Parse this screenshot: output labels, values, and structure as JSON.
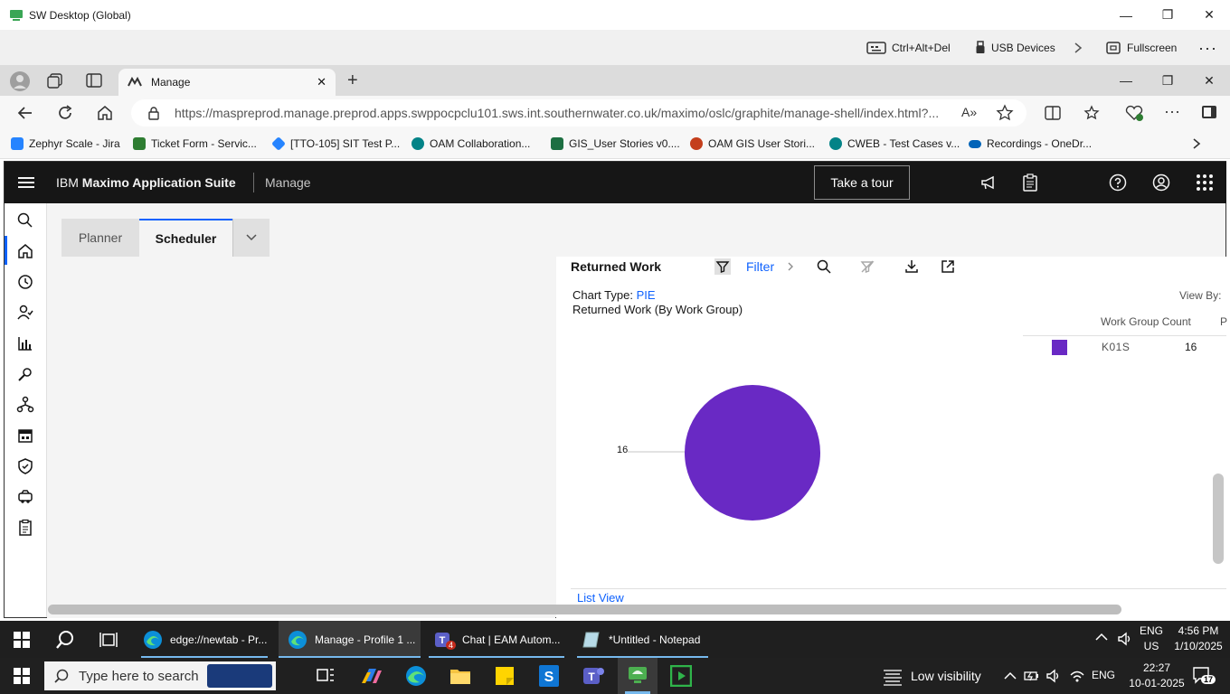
{
  "sw_window": {
    "title": "SW Desktop (Global)"
  },
  "sw_toolbar": {
    "ctrl_alt_del": "Ctrl+Alt+Del",
    "usb_devices": "USB Devices",
    "fullscreen": "Fullscreen"
  },
  "browser": {
    "tab_title": "Manage",
    "url": "https://maspreprod.manage.preprod.apps.swppocpclu101.sws.int.southernwater.co.uk/maximo/oslc/graphite/manage-shell/index.html?...",
    "bookmarks": [
      {
        "label": "Zephyr Scale - Jira",
        "color": "#2684ff"
      },
      {
        "label": "Ticket Form - Servic...",
        "color": "#2e7d32"
      },
      {
        "label": "[TTO-105] SIT Test P...",
        "color": "#2684ff"
      },
      {
        "label": "OAM Collaboration...",
        "color": "#038387"
      },
      {
        "label": "GIS_User Stories v0....",
        "color": "#1d6f42"
      },
      {
        "label": "OAM GIS User Stori...",
        "color": "#c43e1c"
      },
      {
        "label": "CWEB - Test Cases v...",
        "color": "#038387"
      },
      {
        "label": "Recordings - OneDr...",
        "color": "#0364b8"
      }
    ]
  },
  "maximo": {
    "brand_prefix": "IBM",
    "brand_name": "Maximo Application Suite",
    "product": "Manage",
    "tour_button": "Take a tour",
    "tabs": [
      "Planner",
      "Scheduler"
    ],
    "card": {
      "title": "Returned Work",
      "filter_label": "Filter",
      "chart_type_label": "Chart Type:",
      "chart_type_value": "PIE",
      "subtitle": "Returned Work (By Work Group)",
      "view_by": "View By:",
      "legend_header": "Work Group Count",
      "legend_header_trunc": "P",
      "list_view": "List View"
    }
  },
  "chart_data": {
    "type": "pie",
    "subtitle": "Returned Work (By Work Group)",
    "categories": [
      "K01S"
    ],
    "values": [
      16
    ],
    "colors": [
      "#6929c4"
    ],
    "data_labels": [
      "16"
    ]
  },
  "taskbar": {
    "items": [
      {
        "label": "edge://newtab - Pr..."
      },
      {
        "label": "Manage - Profile 1 ..."
      },
      {
        "label": "Chat | EAM Autom...",
        "badge": "4"
      },
      {
        "label": "*Untitled - Notepad"
      }
    ],
    "lang": "ENG",
    "region": "US",
    "time": "4:56 PM",
    "date": "1/10/2025"
  },
  "taskbar2": {
    "search_placeholder": "Type here to search",
    "weather": "Low visibility",
    "lang": "ENG",
    "time": "22:27",
    "date": "10-01-2025",
    "notifications": "17"
  }
}
